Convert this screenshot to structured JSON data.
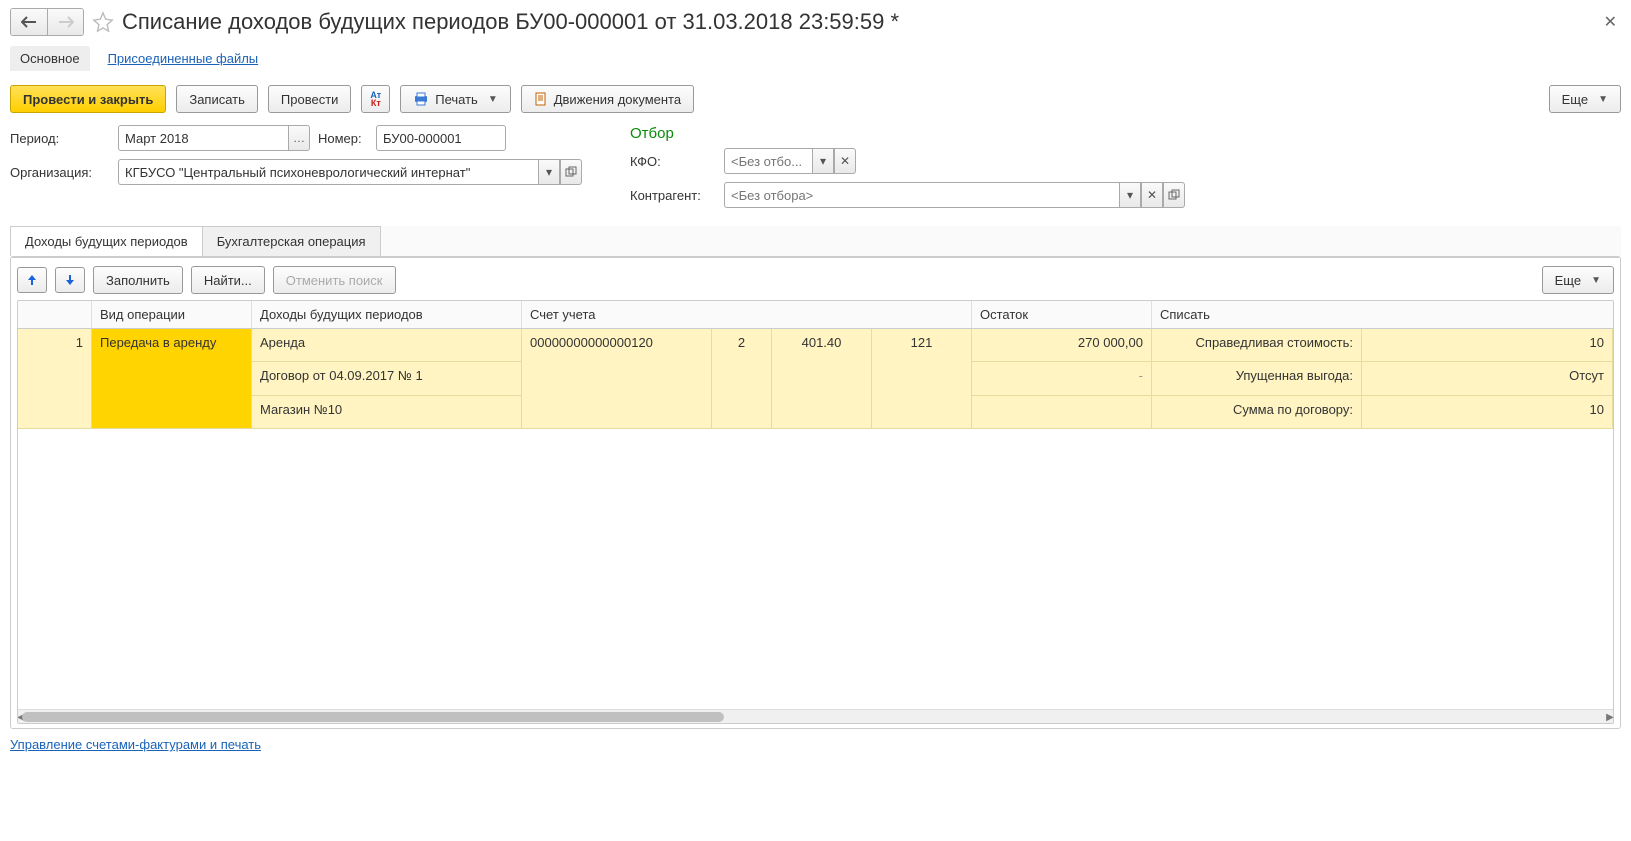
{
  "header": {
    "title": "Списание доходов будущих периодов БУ00-000001 от 31.03.2018 23:59:59 *"
  },
  "subnav": {
    "main": "Основное",
    "attached": "Присоединенные файлы"
  },
  "toolbar": {
    "post_close": "Провести и закрыть",
    "save": "Записать",
    "post": "Провести",
    "print": "Печать",
    "movements": "Движения документа",
    "more": "Еще"
  },
  "form": {
    "period_label": "Период:",
    "period_value": "Март 2018",
    "number_label": "Номер:",
    "number_value": "БУ00-000001",
    "org_label": "Организация:",
    "org_value": "КГБУСО \"Центральный психоневрологический интернат\""
  },
  "filter": {
    "title": "Отбор",
    "kfo_label": "КФО:",
    "kfo_placeholder": "<Без отбо...",
    "contr_label": "Контрагент:",
    "contr_placeholder": "<Без отбора>"
  },
  "tabs": {
    "t1": "Доходы будущих периодов",
    "t2": "Бухгалтерская операция"
  },
  "tbl_toolbar": {
    "fill": "Заполнить",
    "find": "Найти...",
    "cancel_find": "Отменить поиск",
    "more": "Еще"
  },
  "grid": {
    "headers": {
      "num": "",
      "op": "Вид операции",
      "dbp": "Доходы будущих периодов",
      "acc": "Счет учета",
      "ost": "Остаток",
      "spis": "Списать"
    },
    "row": {
      "n": "1",
      "op": "Передача в аренду",
      "dbp": [
        "Аренда",
        "Договор от 04.09.2017 № 1",
        "Магазин №10"
      ],
      "acc": {
        "code": "00000000000000120",
        "k": "2",
        "a": "401.40",
        "s": "121"
      },
      "ost": [
        "270 000,00",
        "-",
        ""
      ],
      "spis": [
        {
          "l": "Справедливая стоимость:",
          "v": "10"
        },
        {
          "l": "Упущенная выгода:",
          "v": "Отсут"
        },
        {
          "l": "Сумма по договору:",
          "v": "10"
        }
      ]
    }
  },
  "footer_link": "Управление счетами-фактурами и печать"
}
